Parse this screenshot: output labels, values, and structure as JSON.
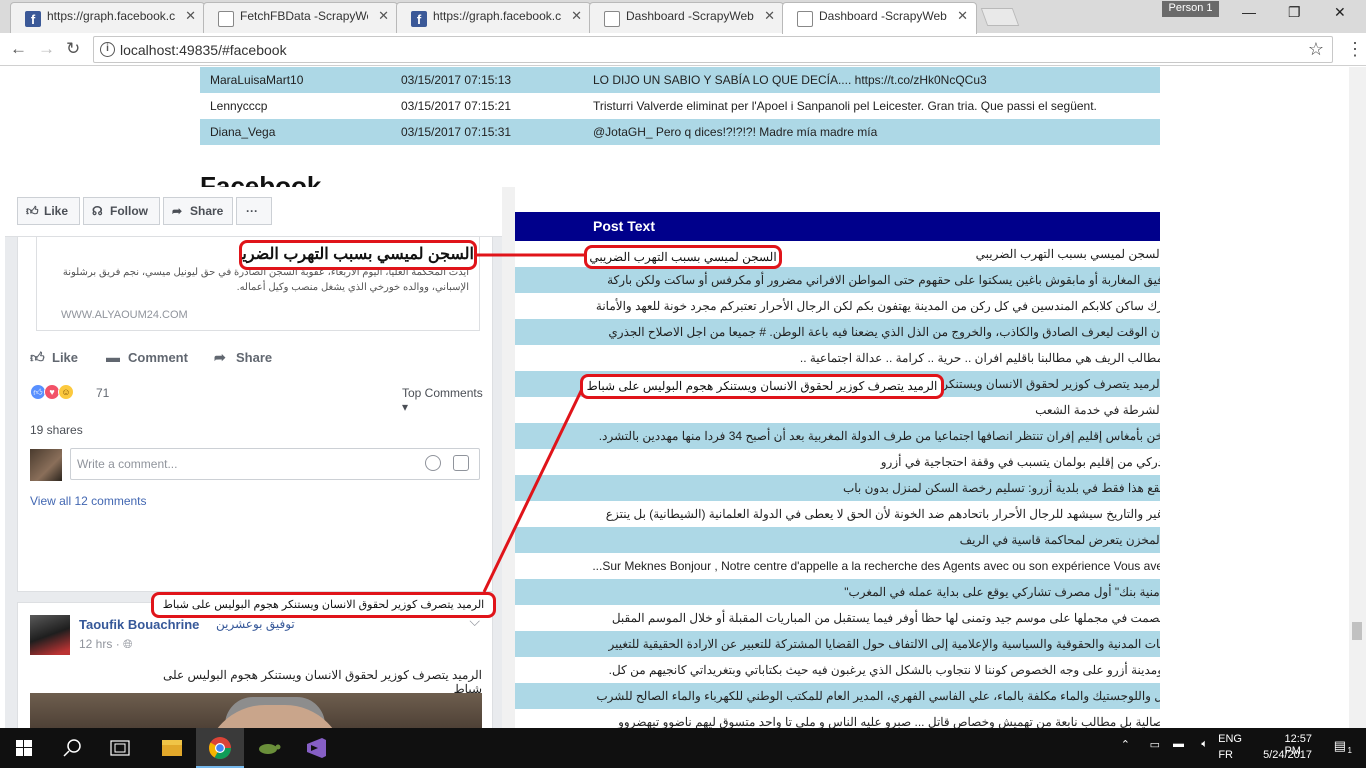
{
  "browser": {
    "tabs": [
      {
        "title": "https://graph.facebook.c",
        "favicon": "facebook-icon",
        "active": false
      },
      {
        "title": "FetchFBData -ScrapyWeb",
        "favicon": "document-icon",
        "active": false
      },
      {
        "title": "https://graph.facebook.c",
        "favicon": "facebook-icon",
        "active": false
      },
      {
        "title": "Dashboard -ScrapyWeb",
        "favicon": "document-icon",
        "active": false
      },
      {
        "title": "Dashboard -ScrapyWeb",
        "favicon": "document-icon",
        "active": true
      }
    ],
    "profile": "Person 1",
    "url": "localhost:49835/#facebook"
  },
  "twitter_rows": [
    {
      "user": "MaraLuisaMart10",
      "date": "03/15/2017 07:15:13",
      "text": "LO DIJO UN SABIO Y SABÍA LO QUE DECÍA.... https://t.co/zHk0NcQCu3"
    },
    {
      "user": "Lennycccp",
      "date": "03/15/2017 07:15:21",
      "text": "Tristurri Valverde eliminat per l'Apoel i Sanpanoli pel Leicester. Gran tria. Que passi el següent."
    },
    {
      "user": "Diana_Vega",
      "date": "03/15/2017 07:15:31",
      "text": "@JotaGH_ Pero q dices!?!?!?! Madre mía madre mía"
    }
  ],
  "facebook_section": {
    "heading": "Facebook",
    "column_header": "Post Text",
    "posts": [
      "السجن لميسي بسبب التهرب الضريبي",
      "فيق المغاربة أو مابقوش باغين يسكتوا على حقهوم حتى المواطن الافراني مضرور أو مكرفس أو ساكت ولكن باركة",
      "رك ساكن كلابكم المندسين في كل ركن من المدينة يهتفون بكم لكن الرجال الأحرار تعتبركم مجرد خونة للعهد والأمانة ...",
      "ان الوقت ليعرف الصادق والكاذب، والخروج من الذل الذي يضعنا فيه باعة الوطن. # جميعا من اجل الاصلاح الجذري",
      "مطالب الريف هي مطالبنا باقليم افران .. حرية .. كرامة .. عدالة اجتماعية ..",
      "الرميد يتصرف كوزير لحقوق الانسان ويستنكر هجوم البوليس على شباط",
      "الشرطة في خدمة الشعب",
      "خن بأمغاس إقليم إفران تنتظر انصافها اجتماعيا من طرف الدولة المغربية بعد أن أصبح 34 فردا منها مهددين بالتشرد.",
      "دركي من إقليم بولمان يتسبب في وقفة احتجاجية في أزرو",
      "يقع هذا فقط في بلدية أزرو: تسليم رخصة السكن لمنزل بدون باب",
      "غير والتاريخ سيشهد للرجال الأحرار باتحادهم ضد الخونة لأن الحق لا يعطى في الدولة العلمانية (الشيطانية) بل ينتزع",
      "المخزن يتعرض لمحاكمة قاسية في الريف",
      "Sur Meknes Bonjour , Notre centre d'appelle a la recherche des Agents avec ou son expérience Vous ave...",
      "أمنية بنك\" أول مصرف تشاركي يوقع على بداية عمله في المغرب\"",
      "بصمت في مجملها على موسم جيد وتمنى لها حظا أوفر فيما يستقبل من المباريات المقبلة أو خلال الموسم المقبل",
      "ئات المدنية والحقوقية والسياسية والإعلامية إلى الالتفاف حول القضايا المشتركة للتعبير عن الارادة الحقيقية للتغيير",
      "ومدينة أزرو على وجه الخصوص كوننا لا نتجاوب بالشكل الذي يرغبون فيه حيث بكتاباتي وبتغريداتي كانجيهم من كل.",
      "ل واللوجستيك والماء مكلفة بالماء، علي الفاسي الفهري، المدير العام للمكتب الوطني للكهرباء والماء الصالح للشرب",
      "صالية بل مطالب نابعة من تهميش وخصاص قاتل ... صبرو عليه الناس و ملي تا واحد متسوق ليهم ناضوو تيهضروو"
    ]
  },
  "fb_card": {
    "toolbar": {
      "like": "Like",
      "follow": "Follow",
      "share": "Share",
      "more": "···"
    },
    "post1": {
      "link_title": "السجن لميسي بسبب التهرب الضريبي",
      "link_desc": "أيدت المحكمة العليا، اليوم الأربعاء، عقوبة السجن الصادرة في حق ليونيل ميسي، نجم فريق برشلونة الإسباني، ووالده خورخي الذي يشغل منصب وكيل أعماله.",
      "link_domain": "WWW.ALYAOUM24.COM",
      "actions": {
        "like": "Like",
        "comment": "Comment",
        "share": "Share"
      },
      "reaction_count": "71",
      "top_comments": "Top Comments",
      "shares": "19 shares",
      "comment_placeholder": "Write a comment...",
      "view_all": "View all 12 comments"
    },
    "post2": {
      "author": "Taoufik Bouachrine",
      "author_ar": "توفيق بوعشرين",
      "time": "12 hrs",
      "text": "الرميد يتصرف كوزير لحقوق الانسان ويستنكر هجوم البوليس على شباط"
    }
  },
  "annotations": {
    "left1": "السجن لميسي بسبب التهرب الضريبي",
    "right1": "السجن لميسي بسبب التهرب الضريبي",
    "right2": "الرميد يتصرف كوزير لحقوق الانسان ويستنكر هجوم البوليس على شباط",
    "left2": "الرميد يتصرف كوزير لحقوق الانسان ويستنكر هجوم البوليس على شباط",
    "color": "#e0141a"
  },
  "taskbar": {
    "apps": [
      "windows-start-icon",
      "search-icon",
      "task-view-icon",
      "file-explorer-icon",
      "chrome-icon",
      "turtle-app-icon",
      "visual-studio-icon"
    ],
    "language": "ENG",
    "layout": "FR",
    "time": "12:57 PM",
    "date": "5/24/2017",
    "notifications": "1"
  }
}
